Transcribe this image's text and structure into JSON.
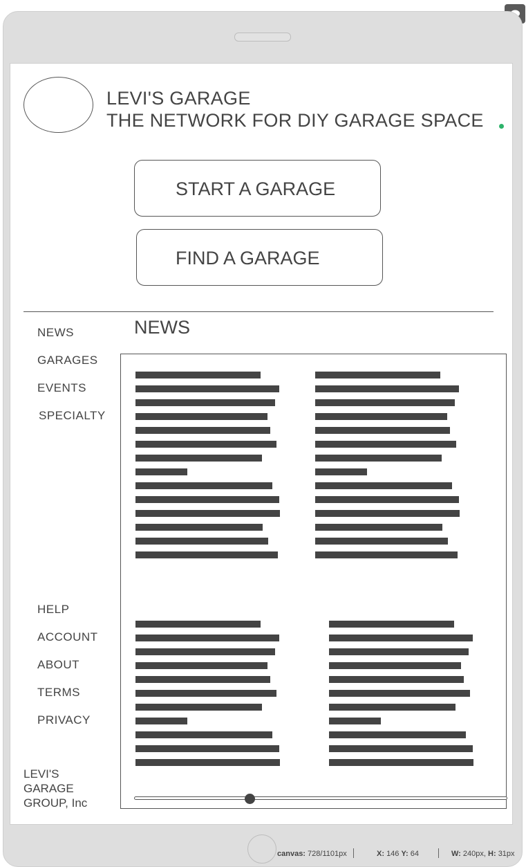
{
  "colors": {
    "accent_dot": "#2db36a",
    "ink": "#444444",
    "device": "#dedede"
  },
  "toolbar": {
    "comment_icon": "speech-bubble-icon",
    "comment_glyph": "🗩"
  },
  "header": {
    "logo": "logo-placeholder",
    "title_line1": "LEVI'S GARAGE",
    "title_line2": "THE NETWORK FOR DIY GARAGE SPACE"
  },
  "actions": {
    "start_label": "START A GARAGE",
    "find_label": "FIND A GARAGE"
  },
  "nav": {
    "primary": [
      "NEWS",
      "GARAGES",
      "EVENTS",
      "SPECIALTY"
    ],
    "secondary": [
      "HELP",
      "ACCOUNT",
      "ABOUT",
      "TERMS",
      "PRIVACY"
    ]
  },
  "main": {
    "section_title": "NEWS"
  },
  "footer": {
    "brand_lines": [
      "LEVI'S",
      "GARAGE",
      "GROUP, Inc"
    ]
  },
  "slider": {
    "value_percent": 31
  },
  "status_bar": {
    "canvas_label": "canvas:",
    "canvas_value": "728/1101px",
    "x_label": "X:",
    "x_value": "146",
    "y_label": "Y:",
    "y_value": "64",
    "w_label": "W:",
    "w_value": "240px,",
    "h_label": "H:",
    "h_value": "31px"
  }
}
